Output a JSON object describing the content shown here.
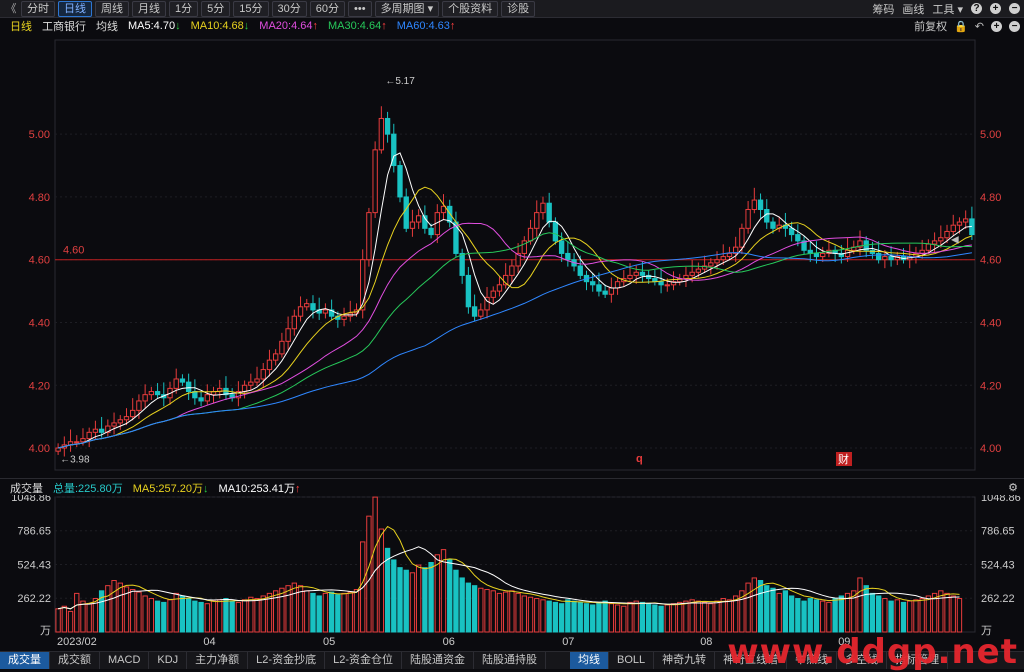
{
  "toolbar": {
    "back_label": "《",
    "tabs": [
      "分时",
      "日线",
      "周线",
      "月线",
      "1分",
      "5分",
      "15分",
      "30分",
      "60分",
      "•••",
      "多周期图 ▾",
      "个股资料",
      "诊股"
    ],
    "active_tab_index": 1,
    "right_items": [
      "筹码",
      "画线",
      "工具 ▾"
    ],
    "right_icons": [
      "help-icon",
      "add-icon",
      "remove-icon"
    ]
  },
  "info": {
    "period": "日线",
    "stock": "工商银行",
    "indicator": "均线",
    "ma5": "MA5:4.70",
    "ma10": "MA10:4.68",
    "ma20": "MA20:4.64",
    "ma30": "MA30:4.64",
    "ma60": "MA60:4.63",
    "right_label": "前复权",
    "colors": {
      "ma5": "#ffffff",
      "ma10": "#e8d21f",
      "ma20": "#e14ee0",
      "ma30": "#27c95b",
      "ma60": "#2f87ff"
    }
  },
  "price_axis": {
    "ticks": [
      "5.00",
      "4.80",
      "4.60",
      "4.40",
      "4.20",
      "4.00"
    ],
    "ylim": [
      3.93,
      5.3
    ],
    "ref_line": "4.60",
    "ref_value": 4.6,
    "high_label": "5.17",
    "low_label": "3.98",
    "markers": [
      "q",
      "财"
    ]
  },
  "volume": {
    "title": "成交量",
    "total": "总量:225.80万",
    "ma5": "MA5:257.20万",
    "ma10": "MA10:253.41万",
    "ticks": [
      "1048.86",
      "786.65",
      "524.43",
      "262.22"
    ],
    "unit": "万",
    "max": 1048.86
  },
  "x_axis": {
    "labels": [
      "2023/02",
      "04",
      "05",
      "06",
      "07",
      "08",
      "09"
    ]
  },
  "bottom_tabs": {
    "left": [
      "成交量",
      "成交额",
      "MACD",
      "KDJ",
      "主力净额",
      "L2-资金抄底",
      "L2-资金仓位",
      "陆股通资金",
      "陆股通持股"
    ],
    "right": [
      "均线",
      "BOLL",
      "神奇九转",
      "神奇五线谱",
      "牛熊线",
      "多空线",
      "指标管理"
    ],
    "active_left": 0,
    "active_right": 0
  },
  "watermark": "www.ddgp.net",
  "chart_data": {
    "type": "candlestick",
    "note_series": [
      "MA5",
      "MA10",
      "MA20",
      "MA30",
      "MA60"
    ],
    "close": [
      4.0,
      4.01,
      4.02,
      4.02,
      4.03,
      4.05,
      4.06,
      4.05,
      4.07,
      4.08,
      4.09,
      4.1,
      4.12,
      4.15,
      4.17,
      4.18,
      4.17,
      4.16,
      4.19,
      4.22,
      4.21,
      4.18,
      4.16,
      4.15,
      4.17,
      4.18,
      4.19,
      4.17,
      4.16,
      4.18,
      4.2,
      4.21,
      4.22,
      4.25,
      4.28,
      4.3,
      4.34,
      4.38,
      4.42,
      4.45,
      4.46,
      4.44,
      4.43,
      4.44,
      4.42,
      4.41,
      4.42,
      4.43,
      4.44,
      4.6,
      4.75,
      4.95,
      5.05,
      5.0,
      4.9,
      4.8,
      4.7,
      4.72,
      4.74,
      4.7,
      4.68,
      4.75,
      4.77,
      4.72,
      4.62,
      4.55,
      4.45,
      4.42,
      4.44,
      4.48,
      4.5,
      4.52,
      4.55,
      4.58,
      4.62,
      4.66,
      4.7,
      4.75,
      4.78,
      4.72,
      4.66,
      4.62,
      4.6,
      4.58,
      4.55,
      4.53,
      4.52,
      4.5,
      4.49,
      4.51,
      4.53,
      4.54,
      4.55,
      4.56,
      4.55,
      4.54,
      4.53,
      4.52,
      4.52,
      4.53,
      4.54,
      4.55,
      4.56,
      4.57,
      4.58,
      4.59,
      4.6,
      4.61,
      4.62,
      4.64,
      4.7,
      4.76,
      4.79,
      4.76,
      4.72,
      4.7,
      4.71,
      4.7,
      4.68,
      4.66,
      4.63,
      4.62,
      4.61,
      4.62,
      4.63,
      4.62,
      4.61,
      4.63,
      4.64,
      4.66,
      4.63,
      4.62,
      4.6,
      4.61,
      4.6,
      4.61,
      4.6,
      4.61,
      4.62,
      4.63,
      4.65,
      4.66,
      4.67,
      4.69,
      4.71,
      4.72,
      4.73,
      4.68
    ],
    "volume": [
      180,
      200,
      160,
      300,
      240,
      220,
      260,
      320,
      360,
      400,
      380,
      350,
      330,
      310,
      280,
      260,
      240,
      230,
      250,
      300,
      280,
      260,
      240,
      230,
      220,
      240,
      250,
      260,
      240,
      230,
      250,
      270,
      260,
      280,
      300,
      320,
      340,
      360,
      380,
      360,
      320,
      300,
      280,
      300,
      310,
      290,
      300,
      310,
      330,
      700,
      900,
      1048,
      800,
      650,
      560,
      500,
      480,
      460,
      520,
      500,
      540,
      600,
      640,
      560,
      480,
      420,
      380,
      360,
      340,
      330,
      320,
      300,
      310,
      320,
      300,
      280,
      270,
      260,
      250,
      240,
      230,
      220,
      250,
      240,
      230,
      220,
      210,
      230,
      240,
      220,
      210,
      200,
      230,
      240,
      230,
      220,
      210,
      200,
      210,
      220,
      230,
      240,
      250,
      240,
      230,
      220,
      240,
      260,
      250,
      280,
      320,
      380,
      420,
      400,
      360,
      340,
      300,
      320,
      280,
      260,
      240,
      260,
      250,
      240,
      230,
      260,
      280,
      300,
      320,
      420,
      360,
      300,
      280,
      260,
      240,
      250,
      230,
      240,
      250,
      260,
      280,
      300,
      320,
      300,
      280,
      260
    ]
  }
}
